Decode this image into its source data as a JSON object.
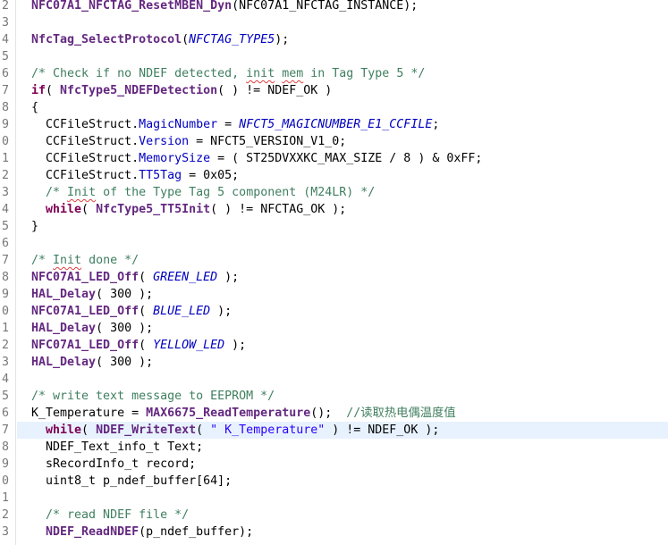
{
  "editor": {
    "current_line": 27,
    "lines": [
      {
        "n": "2",
        "tokens": [
          {
            "t": "NFC07A1_NFCTAG_ResetMBEN_Dyn",
            "c": "fn"
          },
          {
            "t": "(NFC07A1_NFCTAG_INSTANCE);",
            "c": "pl"
          }
        ]
      },
      {
        "n": "3",
        "tokens": []
      },
      {
        "n": "4",
        "tokens": [
          {
            "t": "NfcTag_SelectProtocol",
            "c": "fn"
          },
          {
            "t": "(",
            "c": "pl"
          },
          {
            "t": "NFCTAG_TYPE5",
            "c": "mac"
          },
          {
            "t": ");",
            "c": "pl"
          }
        ]
      },
      {
        "n": "5",
        "tokens": []
      },
      {
        "n": "6",
        "tokens": [
          {
            "t": "/* Check if no NDEF detected, ",
            "c": "cm"
          },
          {
            "t": "init",
            "c": "cm sp"
          },
          {
            "t": " ",
            "c": "cm"
          },
          {
            "t": "mem",
            "c": "cm sp"
          },
          {
            "t": " in Tag Type 5 */",
            "c": "cm"
          }
        ]
      },
      {
        "n": "7",
        "tokens": [
          {
            "t": "if",
            "c": "kw"
          },
          {
            "t": "( ",
            "c": "pl"
          },
          {
            "t": "NfcType5_NDEFDetection",
            "c": "fn"
          },
          {
            "t": "( ) != NDEF_OK )",
            "c": "pl"
          }
        ]
      },
      {
        "n": "8",
        "tokens": [
          {
            "t": "{",
            "c": "pl"
          }
        ]
      },
      {
        "n": "9",
        "tokens": [
          {
            "t": "  CCFileStruct.",
            "c": "pl"
          },
          {
            "t": "MagicNumber",
            "c": "fld"
          },
          {
            "t": " = ",
            "c": "pl"
          },
          {
            "t": "NFCT5_MAGICNUMBER_E1_CCFILE",
            "c": "mac"
          },
          {
            "t": ";",
            "c": "pl"
          }
        ]
      },
      {
        "n": "0",
        "tokens": [
          {
            "t": "  CCFileStruct.",
            "c": "pl"
          },
          {
            "t": "Version",
            "c": "fld"
          },
          {
            "t": " = NFCT5_VERSION_V1_0;",
            "c": "pl"
          }
        ]
      },
      {
        "n": "1",
        "tokens": [
          {
            "t": "  CCFileStruct.",
            "c": "pl"
          },
          {
            "t": "MemorySize",
            "c": "fld"
          },
          {
            "t": " = ( ST25DVXXKC_MAX_SIZE / 8 ) & 0xFF;",
            "c": "pl"
          }
        ]
      },
      {
        "n": "2",
        "tokens": [
          {
            "t": "  CCFileStruct.",
            "c": "pl"
          },
          {
            "t": "TT5Tag",
            "c": "fld"
          },
          {
            "t": " = 0x05;",
            "c": "pl"
          }
        ]
      },
      {
        "n": "3",
        "tokens": [
          {
            "t": "  ",
            "c": "pl"
          },
          {
            "t": "/* ",
            "c": "cm"
          },
          {
            "t": "Init",
            "c": "cm sp"
          },
          {
            "t": " of the Type Tag 5 component (M24LR) */",
            "c": "cm"
          }
        ]
      },
      {
        "n": "4",
        "tokens": [
          {
            "t": "  ",
            "c": "pl"
          },
          {
            "t": "while",
            "c": "kw"
          },
          {
            "t": "( ",
            "c": "pl"
          },
          {
            "t": "NfcType5_TT5Init",
            "c": "fn"
          },
          {
            "t": "( ) != NFCTAG_OK );",
            "c": "pl"
          }
        ]
      },
      {
        "n": "5",
        "tokens": [
          {
            "t": "}",
            "c": "pl"
          }
        ]
      },
      {
        "n": "6",
        "tokens": []
      },
      {
        "n": "7",
        "tokens": [
          {
            "t": "/* ",
            "c": "cm"
          },
          {
            "t": "Init",
            "c": "cm sp"
          },
          {
            "t": " done */",
            "c": "cm"
          }
        ]
      },
      {
        "n": "8",
        "tokens": [
          {
            "t": "NFC07A1_LED_Off",
            "c": "fn"
          },
          {
            "t": "( ",
            "c": "pl"
          },
          {
            "t": "GREEN_LED",
            "c": "mac"
          },
          {
            "t": " );",
            "c": "pl"
          }
        ]
      },
      {
        "n": "9",
        "tokens": [
          {
            "t": "HAL_Delay",
            "c": "fn"
          },
          {
            "t": "( 300 );",
            "c": "pl"
          }
        ]
      },
      {
        "n": "0",
        "tokens": [
          {
            "t": "NFC07A1_LED_Off",
            "c": "fn"
          },
          {
            "t": "( ",
            "c": "pl"
          },
          {
            "t": "BLUE_LED",
            "c": "mac"
          },
          {
            "t": " );",
            "c": "pl"
          }
        ]
      },
      {
        "n": "1",
        "tokens": [
          {
            "t": "HAL_Delay",
            "c": "fn"
          },
          {
            "t": "( 300 );",
            "c": "pl"
          }
        ]
      },
      {
        "n": "2",
        "tokens": [
          {
            "t": "NFC07A1_LED_Off",
            "c": "fn"
          },
          {
            "t": "( ",
            "c": "pl"
          },
          {
            "t": "YELLOW_LED",
            "c": "mac"
          },
          {
            "t": " );",
            "c": "pl"
          }
        ]
      },
      {
        "n": "3",
        "tokens": [
          {
            "t": "HAL_Delay",
            "c": "fn"
          },
          {
            "t": "( 300 );",
            "c": "pl"
          }
        ]
      },
      {
        "n": "4",
        "tokens": []
      },
      {
        "n": "5",
        "tokens": [
          {
            "t": "/* write text message to EEPROM */",
            "c": "cm"
          }
        ]
      },
      {
        "n": "6",
        "tokens": [
          {
            "t": "K_Temperature = ",
            "c": "pl"
          },
          {
            "t": "MAX6675_ReadTemperature",
            "c": "fn"
          },
          {
            "t": "();  ",
            "c": "pl"
          },
          {
            "t": "//读取热电偶温度值",
            "c": "cm"
          }
        ]
      },
      {
        "n": "7",
        "tokens": [
          {
            "t": "  ",
            "c": "pl"
          },
          {
            "t": "while",
            "c": "kw"
          },
          {
            "t": "( ",
            "c": "pl"
          },
          {
            "t": "NDEF_WriteText",
            "c": "fn"
          },
          {
            "t": "( ",
            "c": "pl"
          },
          {
            "t": "\" K_Temperature\"",
            "c": "str"
          },
          {
            "t": " ) != NDEF_OK );",
            "c": "pl"
          }
        ]
      },
      {
        "n": "8",
        "tokens": [
          {
            "t": "  NDEF_Text_info_t Text;",
            "c": "pl"
          }
        ]
      },
      {
        "n": "9",
        "tokens": [
          {
            "t": "  sRecordInfo_t record;",
            "c": "pl"
          }
        ]
      },
      {
        "n": "0",
        "tokens": [
          {
            "t": "  uint8_t p_ndef_buffer[64];",
            "c": "pl"
          }
        ]
      },
      {
        "n": "1",
        "tokens": []
      },
      {
        "n": "2",
        "tokens": [
          {
            "t": "  ",
            "c": "pl"
          },
          {
            "t": "/* read NDEF file */",
            "c": "cm"
          }
        ]
      },
      {
        "n": "3",
        "tokens": [
          {
            "t": "  ",
            "c": "pl"
          },
          {
            "t": "NDEF_ReadNDEF",
            "c": "fn"
          },
          {
            "t": "(p_ndef_buffer);",
            "c": "pl"
          }
        ]
      }
    ]
  }
}
